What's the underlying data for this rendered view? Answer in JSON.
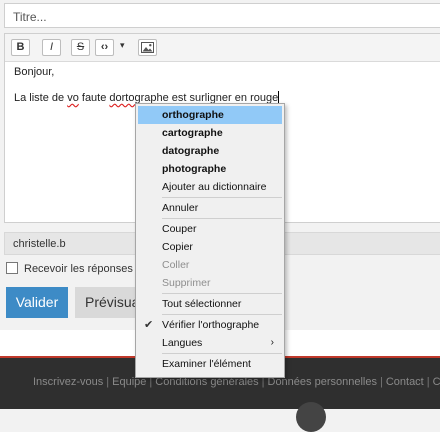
{
  "form": {
    "title_placeholder": "Titre...",
    "editor": {
      "toolbar": {
        "bold": "B",
        "italic": "I",
        "strike": "S",
        "code": "‹›",
        "caret": "▾"
      },
      "line1": "Bonjour,",
      "line2_pre": "La liste de ",
      "line2_err1": "vo",
      "line2_mid1": " faute ",
      "line2_err2": "dortographe",
      "line2_mid2": " est surligner en ",
      "line2_err3": "rouge"
    },
    "author_value": "christelle.b",
    "notify_label": "Recevoir les réponses p",
    "submit_label": "Valider",
    "preview_label": "Prévisua"
  },
  "context_menu": {
    "suggestions": [
      "orthographe",
      "cartographe",
      "datographe",
      "photographe"
    ],
    "add_to_dictionary": "Ajouter au dictionnaire",
    "undo": "Annuler",
    "cut": "Couper",
    "copy": "Copier",
    "paste": "Coller",
    "delete": "Supprimer",
    "select_all": "Tout sélectionner",
    "check_spelling": "Vérifier l'orthographe",
    "languages": "Langues",
    "inspect": "Examiner l'élément"
  },
  "footer": {
    "links": [
      "Inscrivez-vous",
      "Equipe",
      "Conditions générales",
      "Données personnelles",
      "Contact",
      "Cl"
    ]
  },
  "colors": {
    "accent": "#3d8bc6",
    "highlight": "#91c9f7",
    "footer_accent": "#c0392b"
  }
}
